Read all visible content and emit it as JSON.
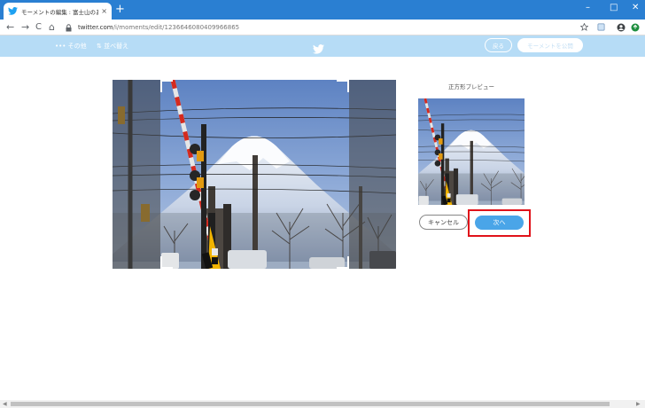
{
  "browser": {
    "tab_title": "モーメントの編集 : 富士山のある風景",
    "tab_close": "×",
    "new_tab": "+",
    "url_host": "twitter.com",
    "url_path": "/i/moments/edit/1236646080409966865",
    "window_controls": [
      "–",
      "□",
      "✕"
    ],
    "nav": {
      "back": "←",
      "forward": "→",
      "reload": "C",
      "home": "⌂"
    },
    "accent": "#2a7fd2"
  },
  "header": {
    "more_label": "••• その他",
    "sort_label": "⇅ 並べ替え",
    "back_label": "戻る",
    "publish_label": "モーメントを公開",
    "bg": "#b6dcf6"
  },
  "editor": {
    "preview_label": "正方形プレビュー",
    "cancel_label": "キャンセル",
    "next_label": "次へ",
    "next_color": "#4aa5e8",
    "highlight_color": "#e0121a"
  }
}
